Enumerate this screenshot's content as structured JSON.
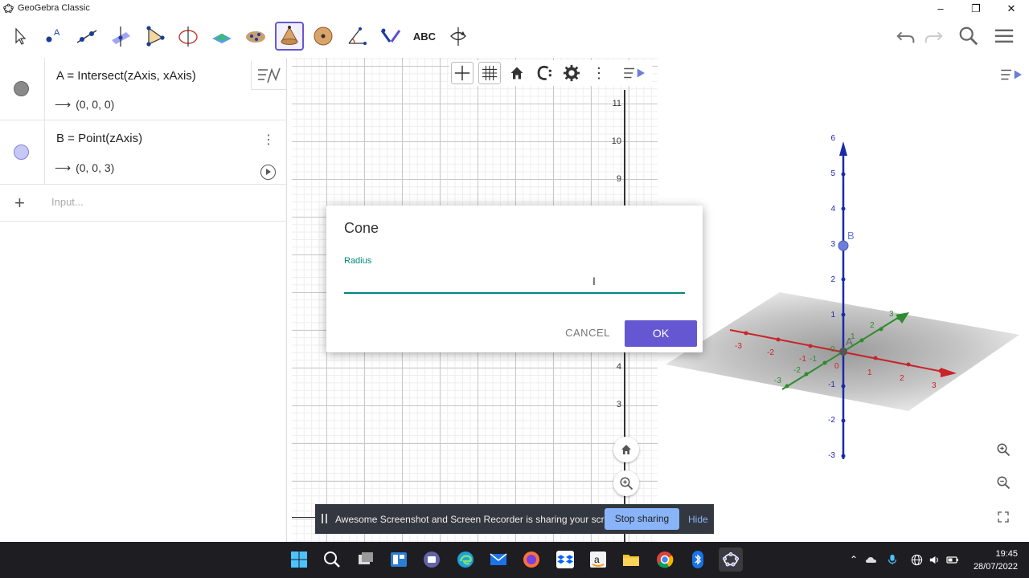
{
  "window": {
    "title": "GeoGebra Classic",
    "controls": [
      "minimize-icon",
      "maximize-icon",
      "close-icon"
    ]
  },
  "toolbar": {
    "tools": [
      {
        "name": "move-tool-icon"
      },
      {
        "name": "point-tool-icon"
      },
      {
        "name": "line-tool-icon"
      },
      {
        "name": "perpendicular-line-tool-icon"
      },
      {
        "name": "polygon-tool-icon"
      },
      {
        "name": "circle-axis-tool-icon"
      },
      {
        "name": "intersect-surfaces-tool-icon"
      },
      {
        "name": "pyramid-tool-icon"
      },
      {
        "name": "cone-tool-icon",
        "selected": true
      },
      {
        "name": "sphere-tool-icon"
      },
      {
        "name": "angle-tool-icon"
      },
      {
        "name": "reflect-tool-icon"
      },
      {
        "name": "text-tool-icon",
        "label": "ABC"
      },
      {
        "name": "rotate-view-tool-icon"
      }
    ],
    "right": [
      "undo-icon",
      "redo-icon",
      "search-icon",
      "menu-icon"
    ],
    "accent": "#6557d2"
  },
  "algebra": {
    "rows": [
      {
        "definition": "A = Intersect(zAxis, xAxis)",
        "value": "(0, 0, 0)",
        "marker_color": "#8a8a8a"
      },
      {
        "definition": "B = Point(zAxis)",
        "value": "(0, 0, 3)",
        "marker_color": "#b4b4f0"
      }
    ],
    "input_placeholder": "Input..."
  },
  "graphics2d": {
    "y_ticks": [
      "11",
      "10",
      "9",
      "4",
      "3"
    ]
  },
  "graphics3d": {
    "z_ticks": [
      "6",
      "5",
      "4",
      "3",
      "2",
      "1",
      "-1",
      "-2",
      "-3"
    ],
    "point_labels": [
      "B",
      "A"
    ],
    "x_ticks": [
      "-3",
      "-2",
      "-1",
      "0",
      "1",
      "2",
      "3"
    ],
    "y_ticks": [
      "-3",
      "-2",
      "-1",
      "0",
      "1",
      "2",
      "3"
    ]
  },
  "dialog": {
    "title": "Cone",
    "field_label": "Radius",
    "field_value": "",
    "cancel_label": "CANCEL",
    "ok_label": "OK"
  },
  "share_banner": {
    "message": "Awesome Screenshot and Screen Recorder is sharing your screen.",
    "stop_label": "Stop sharing",
    "hide_label": "Hide"
  },
  "taskbar": {
    "time": "19:45",
    "date": "28/07/2022"
  }
}
